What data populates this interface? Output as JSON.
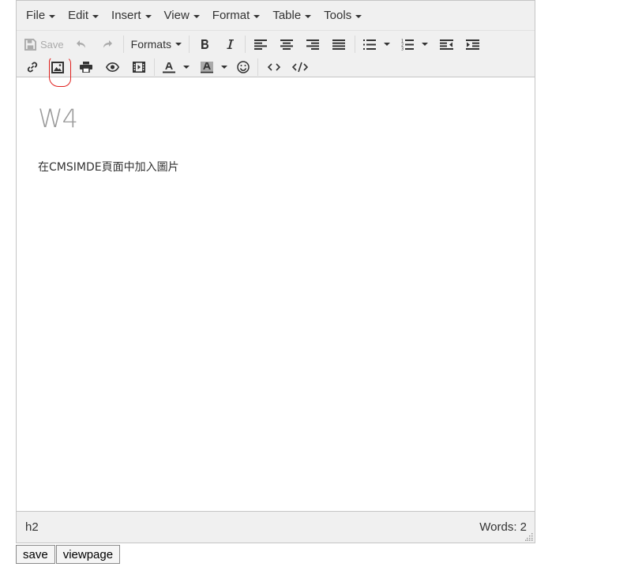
{
  "menubar": {
    "items": [
      "File",
      "Edit",
      "Insert",
      "View",
      "Format",
      "Table",
      "Tools"
    ]
  },
  "toolbar": {
    "save_label": "Save",
    "formats_label": "Formats",
    "icons": {
      "save": "save-icon",
      "undo": "undo-icon",
      "redo": "redo-icon",
      "bold": "bold-icon",
      "italic": "italic-icon",
      "link": "link-icon",
      "image": "image-icon",
      "print": "print-icon",
      "preview": "eye-icon",
      "media": "film-icon",
      "emoticons": "smiley-icon",
      "code": "code-icon",
      "source": "source-code-icon"
    },
    "highlight_color": "#e0201e"
  },
  "content": {
    "heading": "W4",
    "paragraph": "在CMSIMDE頁面中加入圖片"
  },
  "statusbar": {
    "path": "h2",
    "word_count": "Words: 2"
  },
  "buttons": {
    "save": "save",
    "viewpage": "viewpage"
  }
}
